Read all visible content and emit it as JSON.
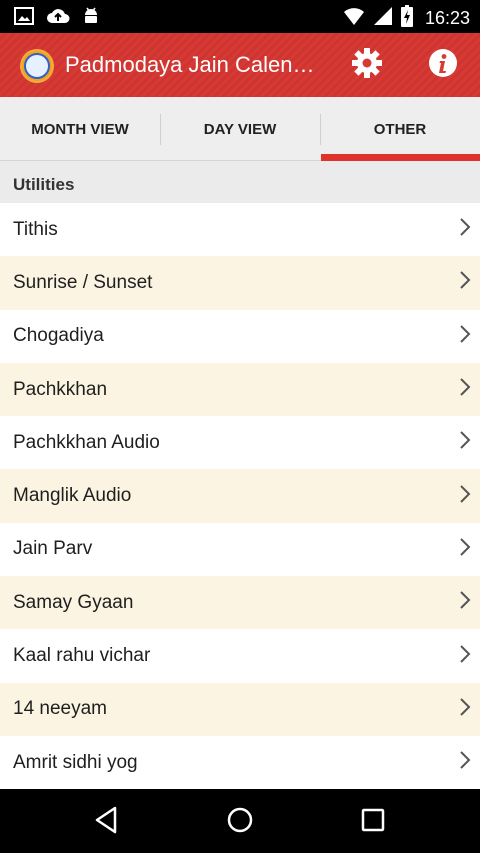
{
  "status_bar": {
    "time": "16:23",
    "icons": [
      "image-icon",
      "cloud-upload-icon",
      "android-icon",
      "wifi-icon",
      "cell-signal-icon",
      "battery-charging-icon"
    ]
  },
  "app_bar": {
    "title": "Padmodaya Jain Calendar",
    "actions": [
      "settings-icon",
      "info-icon"
    ],
    "color": "#d63a35"
  },
  "tabs": [
    {
      "label": "MONTH VIEW",
      "selected": false
    },
    {
      "label": "DAY VIEW",
      "selected": false
    },
    {
      "label": "OTHER",
      "selected": true
    }
  ],
  "section": {
    "title": "Utilities"
  },
  "items": [
    {
      "label": "Tithis"
    },
    {
      "label": "Sunrise / Sunset"
    },
    {
      "label": "Chogadiya"
    },
    {
      "label": "Pachkkhan"
    },
    {
      "label": "Pachkkhan Audio"
    },
    {
      "label": "Manglik Audio"
    },
    {
      "label": "Jain Parv"
    },
    {
      "label": "Samay Gyaan"
    },
    {
      "label": "Kaal rahu vichar"
    },
    {
      "label": "14 neeyam"
    },
    {
      "label": "Amrit sidhi yog"
    }
  ],
  "nav_bar": {
    "buttons": [
      "back-icon",
      "home-icon",
      "recents-icon"
    ]
  },
  "colors": {
    "accent": "#e0322c",
    "alt_row": "#fbf4e2"
  }
}
